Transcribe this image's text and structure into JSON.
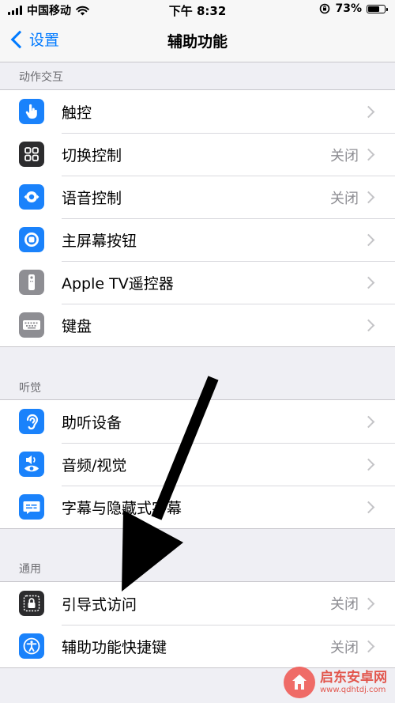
{
  "status_bar": {
    "carrier": "中国移动",
    "time": "下午 8:32",
    "battery": "73%",
    "battery_level": 0.73
  },
  "nav": {
    "back_label": "设置",
    "title": "辅助功能"
  },
  "sections": [
    {
      "header": "动作交互",
      "items": [
        {
          "label": "触控",
          "value": "",
          "icon": "hand-touch-icon",
          "color": "#1a82fb"
        },
        {
          "label": "切换控制",
          "value": "关闭",
          "icon": "switch-control-grid-icon",
          "color": "#2c2c2e"
        },
        {
          "label": "语音控制",
          "value": "关闭",
          "icon": "voice-control-icon",
          "color": "#1a82fb"
        },
        {
          "label": "主屏幕按钮",
          "value": "",
          "icon": "home-button-icon",
          "color": "#1a82fb"
        },
        {
          "label": "Apple TV遥控器",
          "value": "",
          "icon": "tv-remote-icon",
          "color": "#8e8e93"
        },
        {
          "label": "键盘",
          "value": "",
          "icon": "keyboard-icon",
          "color": "#8e8e93"
        }
      ]
    },
    {
      "header": "听觉",
      "items": [
        {
          "label": "助听设备",
          "value": "",
          "icon": "ear-icon",
          "color": "#1a82fb"
        },
        {
          "label": "音频/视觉",
          "value": "",
          "icon": "audio-visual-icon",
          "color": "#1a82fb"
        },
        {
          "label": "字幕与隐藏式字幕",
          "value": "",
          "icon": "captions-icon",
          "color": "#1a82fb"
        }
      ]
    },
    {
      "header": "通用",
      "items": [
        {
          "label": "引导式访问",
          "value": "关闭",
          "icon": "guided-access-lock-icon",
          "color": "#2c2c2e"
        },
        {
          "label": "辅助功能快捷键",
          "value": "关闭",
          "icon": "accessibility-shortcut-icon",
          "color": "#1a82fb"
        }
      ]
    }
  ],
  "watermark": {
    "name": "启东安卓网",
    "url": "www.qdhtdj.com"
  }
}
